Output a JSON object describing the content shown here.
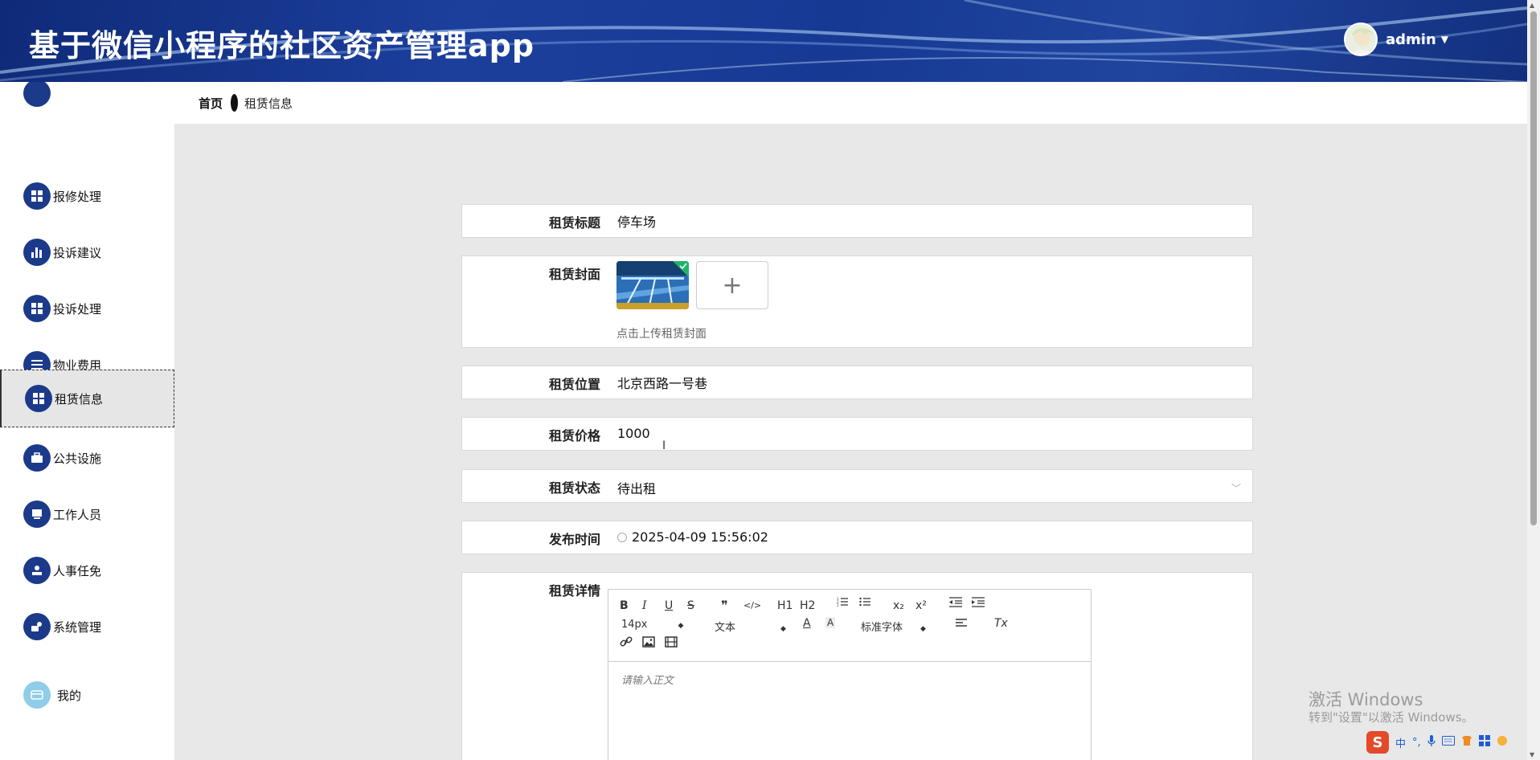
{
  "header": {
    "title": "基于微信小程序的社区资产管理app",
    "username": "admin"
  },
  "sidebar": {
    "items": [
      {
        "label": "报修处理",
        "icon": "grid-icon"
      },
      {
        "label": "投诉建议",
        "icon": "bar-chart-icon"
      },
      {
        "label": "投诉处理",
        "icon": "grid-icon"
      },
      {
        "label": "物业费用",
        "icon": "list-icon"
      },
      {
        "label": "租赁信息",
        "icon": "grid-icon"
      },
      {
        "label": "公共设施",
        "icon": "briefcase-icon"
      },
      {
        "label": "工作人员",
        "icon": "monitor-icon"
      },
      {
        "label": "人事任免",
        "icon": "person-icon"
      },
      {
        "label": "系统管理",
        "icon": "settings-hand-icon"
      },
      {
        "label": "我的",
        "icon": "card-icon"
      }
    ]
  },
  "breadcrumb": {
    "home": "首页",
    "current": "租赁信息"
  },
  "form": {
    "title_label": "租赁标题",
    "title_value": "停车场",
    "cover_label": "租赁封面",
    "cover_hint": "点击上传租赁封面",
    "upload_symbol": "+",
    "location_label": "租赁位置",
    "location_value": "北京西路一号巷",
    "price_label": "租赁价格",
    "price_value": "1000",
    "status_label": "租赁状态",
    "status_value": "待出租",
    "time_label": "发布时间",
    "time_value": "2025-04-09 15:56:02",
    "detail_label": "租赁详情",
    "editor": {
      "font_size": "14px",
      "header_select": "文本",
      "font_family": "标准字体",
      "placeholder": "请输入正文",
      "tools": [
        "B",
        "I",
        "U",
        "S",
        "❞",
        "</>",
        "H1",
        "H2",
        "x₂",
        "x²",
        "Tx"
      ]
    }
  },
  "watermark": {
    "line1": "激活 Windows",
    "line2": "转到\"设置\"以激活 Windows。"
  },
  "ime": {
    "lang": "中"
  }
}
